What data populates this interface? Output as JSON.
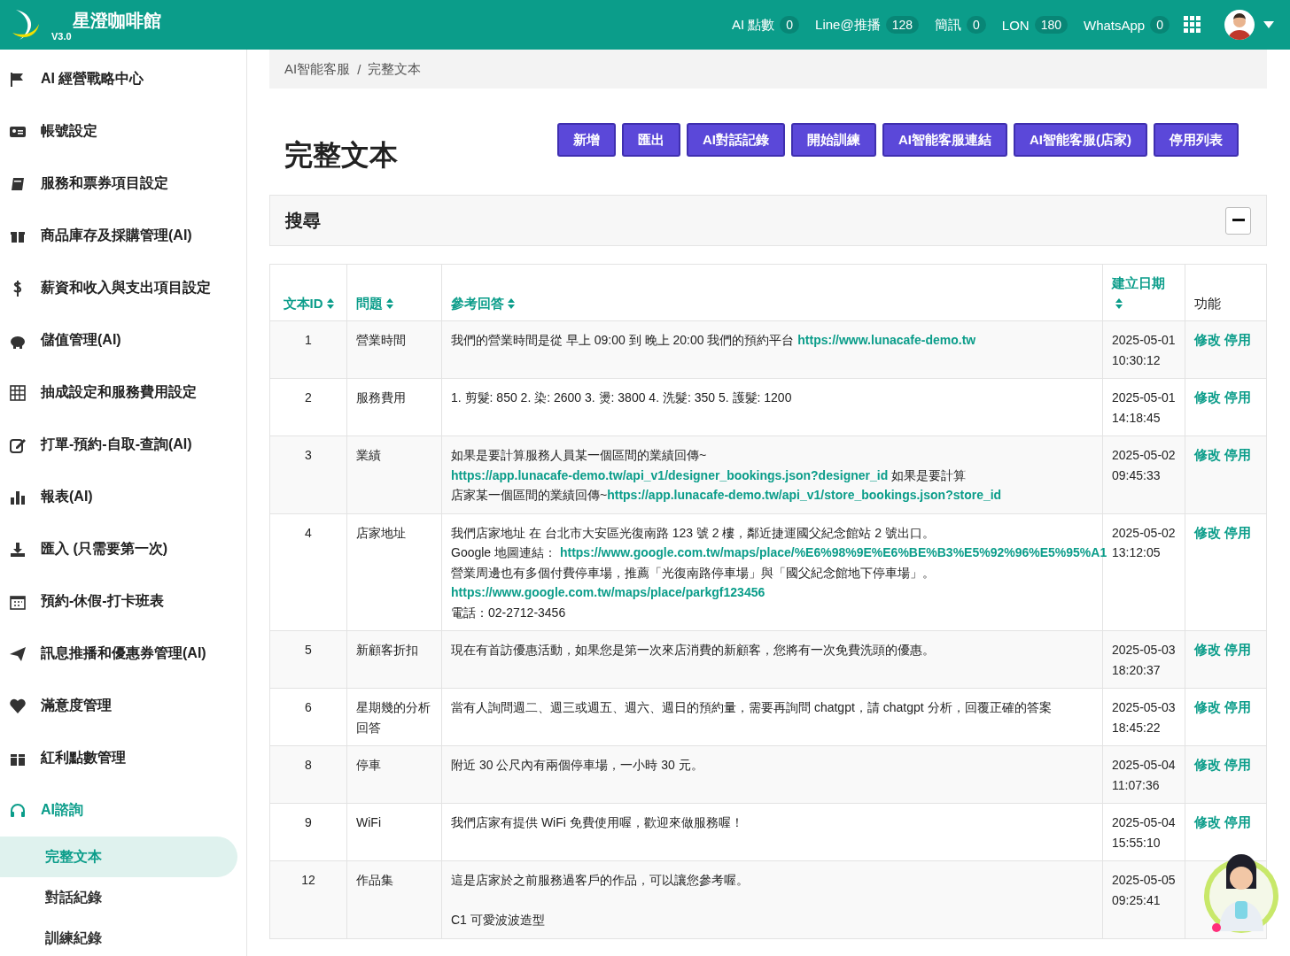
{
  "header": {
    "title": "星澄咖啡館",
    "version": "V3.0",
    "stats": [
      {
        "label": "AI 點數",
        "value": "0"
      },
      {
        "label": "Line@推播",
        "value": "128"
      },
      {
        "label": "簡訊",
        "value": "0"
      },
      {
        "label": "LON",
        "value": "180"
      },
      {
        "label": "WhatsApp",
        "value": "0"
      }
    ]
  },
  "sidebar": {
    "items": [
      {
        "label": "AI 經營戰略中心",
        "expanded": false
      },
      {
        "label": "帳號設定",
        "expanded": false
      },
      {
        "label": "服務和票券項目設定",
        "expanded": false
      },
      {
        "label": "商品庫存及採購管理(AI)",
        "expanded": false
      },
      {
        "label": "薪資和收入與支出項目設定",
        "expanded": false
      },
      {
        "label": "儲值管理(AI)",
        "expanded": false
      },
      {
        "label": "抽成設定和服務費用設定",
        "expanded": false
      },
      {
        "label": "打單-預約-自取-查詢(AI)",
        "expanded": false
      },
      {
        "label": "報表(AI)",
        "expanded": false
      },
      {
        "label": "匯入 (只需要第一次)",
        "expanded": false
      },
      {
        "label": "預約-休假-打卡班表",
        "expanded": false
      },
      {
        "label": "訊息推播和優惠券管理(AI)",
        "expanded": false
      },
      {
        "label": "滿意度管理",
        "expanded": false
      },
      {
        "label": "紅利點數管理",
        "expanded": false
      },
      {
        "label": "AI諮詢",
        "expanded": true,
        "children": [
          {
            "label": "完整文本",
            "selected": true
          },
          {
            "label": "對話紀錄",
            "selected": false
          },
          {
            "label": "訓練紀錄",
            "selected": false
          }
        ]
      }
    ]
  },
  "breadcrumb": {
    "items": [
      "AI智能客服",
      "完整文本"
    ],
    "separator": "/"
  },
  "page_title": "完整文本",
  "buttons": [
    "新增",
    "匯出",
    "AI對話記錄",
    "開始訓練",
    "AI智能客服連結",
    "AI智能客服(店家)",
    "停用列表"
  ],
  "search_panel": {
    "title": "搜尋"
  },
  "table": {
    "columns": [
      {
        "label": "文本ID",
        "sortable": true
      },
      {
        "label": "問題",
        "sortable": true
      },
      {
        "label": "參考回答",
        "sortable": true
      },
      {
        "label": "建立日期",
        "sortable": true
      },
      {
        "label": "功能",
        "sortable": false
      }
    ],
    "rows": [
      {
        "id": "1",
        "question": "營業時間",
        "answer": [
          [
            [
              {
                "text": "我們的營業時間是從 早上 09:00 到 晚上 20:00 我們的預約平台 ",
                "link": false
              },
              {
                "text": "https://www.lunacafe-demo.tw",
                "link": true
              }
            ]
          ]
        ],
        "created": "2025-05-01 10:30:12",
        "actions": [
          "修改",
          "停用"
        ]
      },
      {
        "id": "2",
        "question": "服務費用",
        "answer": [
          [
            [
              {
                "text": "1. 剪髮: 850 2. 染: 2600 3. 燙: 3800 4. 洗髮: 350 5. 護髮: 1200",
                "link": false
              }
            ]
          ]
        ],
        "created": "2025-05-01 14:18:45",
        "actions": [
          "修改",
          "停用"
        ]
      },
      {
        "id": "3",
        "question": "業績",
        "answer": [
          [
            [
              {
                "text": "如果是要計算服務人員某一個區間的業績回傳~",
                "link": false
              }
            ],
            [
              {
                "text": "https://app.lunacafe-demo.tw/api_v1/designer_bookings.json?designer_id",
                "link": true
              },
              {
                "text": " 如果是要計算",
                "link": false
              }
            ],
            [
              {
                "text": "店家某一個區間的業績回傳~",
                "link": false
              },
              {
                "text": "https://app.lunacafe-demo.tw/api_v1/store_bookings.json?store_id",
                "link": true
              }
            ]
          ]
        ],
        "created": "2025-05-02 09:45:33",
        "actions": [
          "修改",
          "停用"
        ]
      },
      {
        "id": "4",
        "question": "店家地址",
        "answer": [
          [
            [
              {
                "text": "我們店家地址 在 台北市大安區光復南路 123 號 2 樓，鄰近捷運國父紀念館站 2 號出口。",
                "link": false
              }
            ],
            [
              {
                "text": "Google 地圖連結： ",
                "link": false
              },
              {
                "text": "https://www.google.com.tw/maps/place/%E6%98%9E%E6%BE%B3%E5%92%96%E5%95%A1",
                "link": true
              }
            ],
            [
              {
                "text": "營業周邊也有多個付費停車場，推薦「光復南路停車場」與「國父紀念館地下停車場」。",
                "link": false
              }
            ],
            [
              {
                "text": "https://www.google.com.tw/maps/place/parkgf123456",
                "link": true
              }
            ],
            [
              {
                "text": "電話：02-2712-3456",
                "link": false
              }
            ]
          ]
        ],
        "created": "2025-05-02 13:12:05",
        "actions": [
          "修改",
          "停用"
        ]
      },
      {
        "id": "5",
        "question": "新顧客折扣",
        "answer": [
          [
            [
              {
                "text": "現在有首訪優惠活動，如果您是第一次來店消費的新顧客，您將有一次免費洗頭的優惠。",
                "link": false
              }
            ]
          ]
        ],
        "created": "2025-05-03 18:20:37",
        "actions": [
          "修改",
          "停用"
        ]
      },
      {
        "id": "6",
        "question": "星期幾的分析回答",
        "answer": [
          [
            [
              {
                "text": "當有人詢問週二、週三或週五、週六、週日的預約量，需要再詢問 chatgpt，請 chatgpt 分析，回覆正確的答案",
                "link": false
              }
            ]
          ]
        ],
        "created": "2025-05-03 18:45:22",
        "actions": [
          "修改",
          "停用"
        ]
      },
      {
        "id": "8",
        "question": "停車",
        "answer": [
          [
            [
              {
                "text": "附近 30 公尺內有兩個停車場，一小時 30 元。",
                "link": false
              }
            ]
          ]
        ],
        "created": "2025-05-04 11:07:36",
        "actions": [
          "修改",
          "停用"
        ]
      },
      {
        "id": "9",
        "question": "WiFi",
        "answer": [
          [
            [
              {
                "text": "我們店家有提供 WiFi 免費使用喔，歡迎來做服務喔！",
                "link": false
              }
            ]
          ]
        ],
        "created": "2025-05-04 15:55:10",
        "actions": [
          "修改",
          "停用"
        ]
      },
      {
        "id": "12",
        "question": "作品集",
        "answer": [
          [
            [
              {
                "text": "這是店家於之前服務過客戶的作品，可以讓您參考喔。",
                "link": false
              }
            ]
          ],
          [
            [
              {
                "text": "C1 可愛波波造型",
                "link": false
              }
            ]
          ]
        ],
        "created": "2025-05-05 09:25:41",
        "actions": []
      }
    ]
  }
}
